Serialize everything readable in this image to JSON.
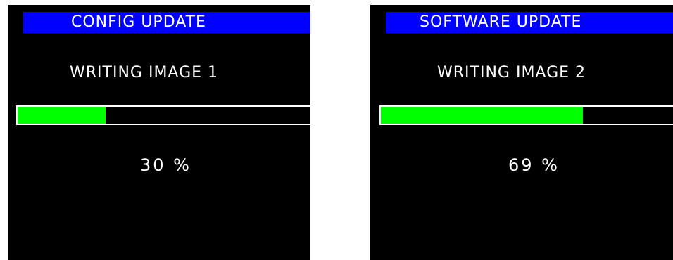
{
  "colors": {
    "background": "#000000",
    "title_bar": "#0000ff",
    "progress_fill": "#00ff00",
    "text": "#ffffff"
  },
  "screens": [
    {
      "title": "CONFIG UPDATE",
      "status": "WRITING IMAGE 1",
      "progress": 30,
      "percent_label": "30 %"
    },
    {
      "title": "SOFTWARE UPDATE",
      "status": "WRITING IMAGE 2",
      "progress": 69,
      "percent_label": "69 %"
    }
  ]
}
